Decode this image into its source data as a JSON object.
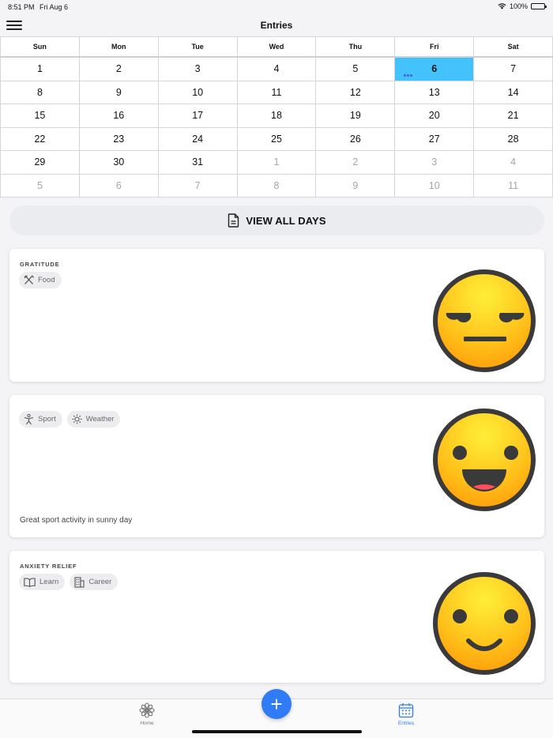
{
  "status": {
    "time": "8:51 PM",
    "date": "Fri Aug 6",
    "battery": "100%"
  },
  "nav": {
    "title": "Entries"
  },
  "calendar": {
    "weekdays": [
      "Sun",
      "Mon",
      "Tue",
      "Wed",
      "Thu",
      "Fri",
      "Sat"
    ],
    "selected_day": "6",
    "weeks": [
      [
        {
          "d": "1"
        },
        {
          "d": "2"
        },
        {
          "d": "3"
        },
        {
          "d": "4"
        },
        {
          "d": "5"
        },
        {
          "d": "6",
          "selected": true,
          "dots": true
        },
        {
          "d": "7"
        }
      ],
      [
        {
          "d": "8"
        },
        {
          "d": "9"
        },
        {
          "d": "10"
        },
        {
          "d": "11"
        },
        {
          "d": "12"
        },
        {
          "d": "13"
        },
        {
          "d": "14"
        }
      ],
      [
        {
          "d": "15"
        },
        {
          "d": "16"
        },
        {
          "d": "17"
        },
        {
          "d": "18"
        },
        {
          "d": "19"
        },
        {
          "d": "20"
        },
        {
          "d": "21"
        }
      ],
      [
        {
          "d": "22"
        },
        {
          "d": "23"
        },
        {
          "d": "24"
        },
        {
          "d": "25"
        },
        {
          "d": "26"
        },
        {
          "d": "27"
        },
        {
          "d": "28"
        }
      ],
      [
        {
          "d": "29"
        },
        {
          "d": "30"
        },
        {
          "d": "31"
        },
        {
          "d": "1",
          "dim": true
        },
        {
          "d": "2",
          "dim": true
        },
        {
          "d": "3",
          "dim": true
        },
        {
          "d": "4",
          "dim": true
        }
      ],
      [
        {
          "d": "5",
          "dim": true
        },
        {
          "d": "6",
          "dim": true
        },
        {
          "d": "7",
          "dim": true
        },
        {
          "d": "8",
          "dim": true
        },
        {
          "d": "9",
          "dim": true
        },
        {
          "d": "10",
          "dim": true
        },
        {
          "d": "11",
          "dim": true
        }
      ]
    ]
  },
  "view_all": {
    "label": "VIEW ALL DAYS",
    "icon": "document-icon"
  },
  "entries": [
    {
      "title": "GRATITUDE",
      "tags": [
        {
          "label": "Food",
          "icon": "utensils-icon"
        }
      ],
      "note": "",
      "mood": "unamused-face"
    },
    {
      "title": "",
      "tags": [
        {
          "label": "Sport",
          "icon": "athlete-icon"
        },
        {
          "label": "Weather",
          "icon": "sun-icon"
        }
      ],
      "note": "Great sport activity in sunny day",
      "mood": "grinning-face"
    },
    {
      "title": "ANXIETY RELIEF",
      "tags": [
        {
          "label": "Learn",
          "icon": "book-icon"
        },
        {
          "label": "Career",
          "icon": "building-icon"
        }
      ],
      "note": "",
      "mood": "smiling-face"
    }
  ],
  "tabs": [
    {
      "label": "Home",
      "icon": "flower-icon",
      "active": false
    },
    {
      "label": "Entries",
      "icon": "calendar-icon",
      "active": true
    }
  ],
  "fab": {
    "label": "+"
  },
  "colors": {
    "accent": "#2f7cf6",
    "selected_day": "#44c2fb",
    "dot": "#4a58e0"
  }
}
